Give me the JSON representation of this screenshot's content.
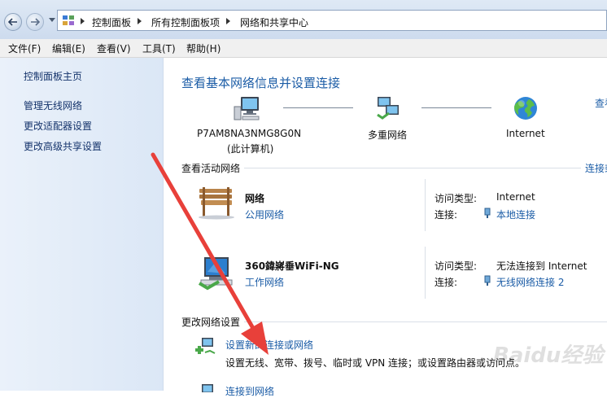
{
  "breadcrumb": [
    "控制面板",
    "所有控制面板项",
    "网络和共享中心"
  ],
  "menu": [
    "文件(F)",
    "编辑(E)",
    "查看(V)",
    "工具(T)",
    "帮助(H)"
  ],
  "sidebar": {
    "home": "控制面板主页",
    "items": [
      "管理无线网络",
      "更改适配器设置",
      "更改高级共享设置"
    ]
  },
  "main": {
    "title": "查看基本网络信息并设置连接",
    "top_right_link": "查看",
    "map": {
      "computer_name": "P7AM8NA3NMG8G0N",
      "computer_sub": "(此计算机)",
      "multi_network": "多重网络",
      "internet": "Internet"
    },
    "active_section": {
      "heading": "查看活动网络",
      "right_link": "连接或",
      "networks": [
        {
          "name": "网络",
          "type_link": "公用网络",
          "access_label": "访问类型:",
          "access_value": "Internet",
          "conn_label": "连接:",
          "conn_link": "本地连接"
        },
        {
          "name": "360鍏嶈垂WiFi-NG",
          "type_link": "工作网络",
          "access_label": "访问类型:",
          "access_value": "无法连接到 Internet",
          "conn_label": "连接:",
          "conn_link": "无线网络连接 2"
        }
      ]
    },
    "change_section": {
      "heading": "更改网络设置",
      "tasks": [
        {
          "link": "设置新的连接或网络",
          "desc": "设置无线、宽带、拨号、临时或 VPN 连接；或设置路由器或访问点。"
        },
        {
          "link": "连接到网络"
        }
      ]
    }
  },
  "watermark": "Baidu经验",
  "colors": {
    "link": "#1b5ca6",
    "arrow": "#e8403a"
  }
}
